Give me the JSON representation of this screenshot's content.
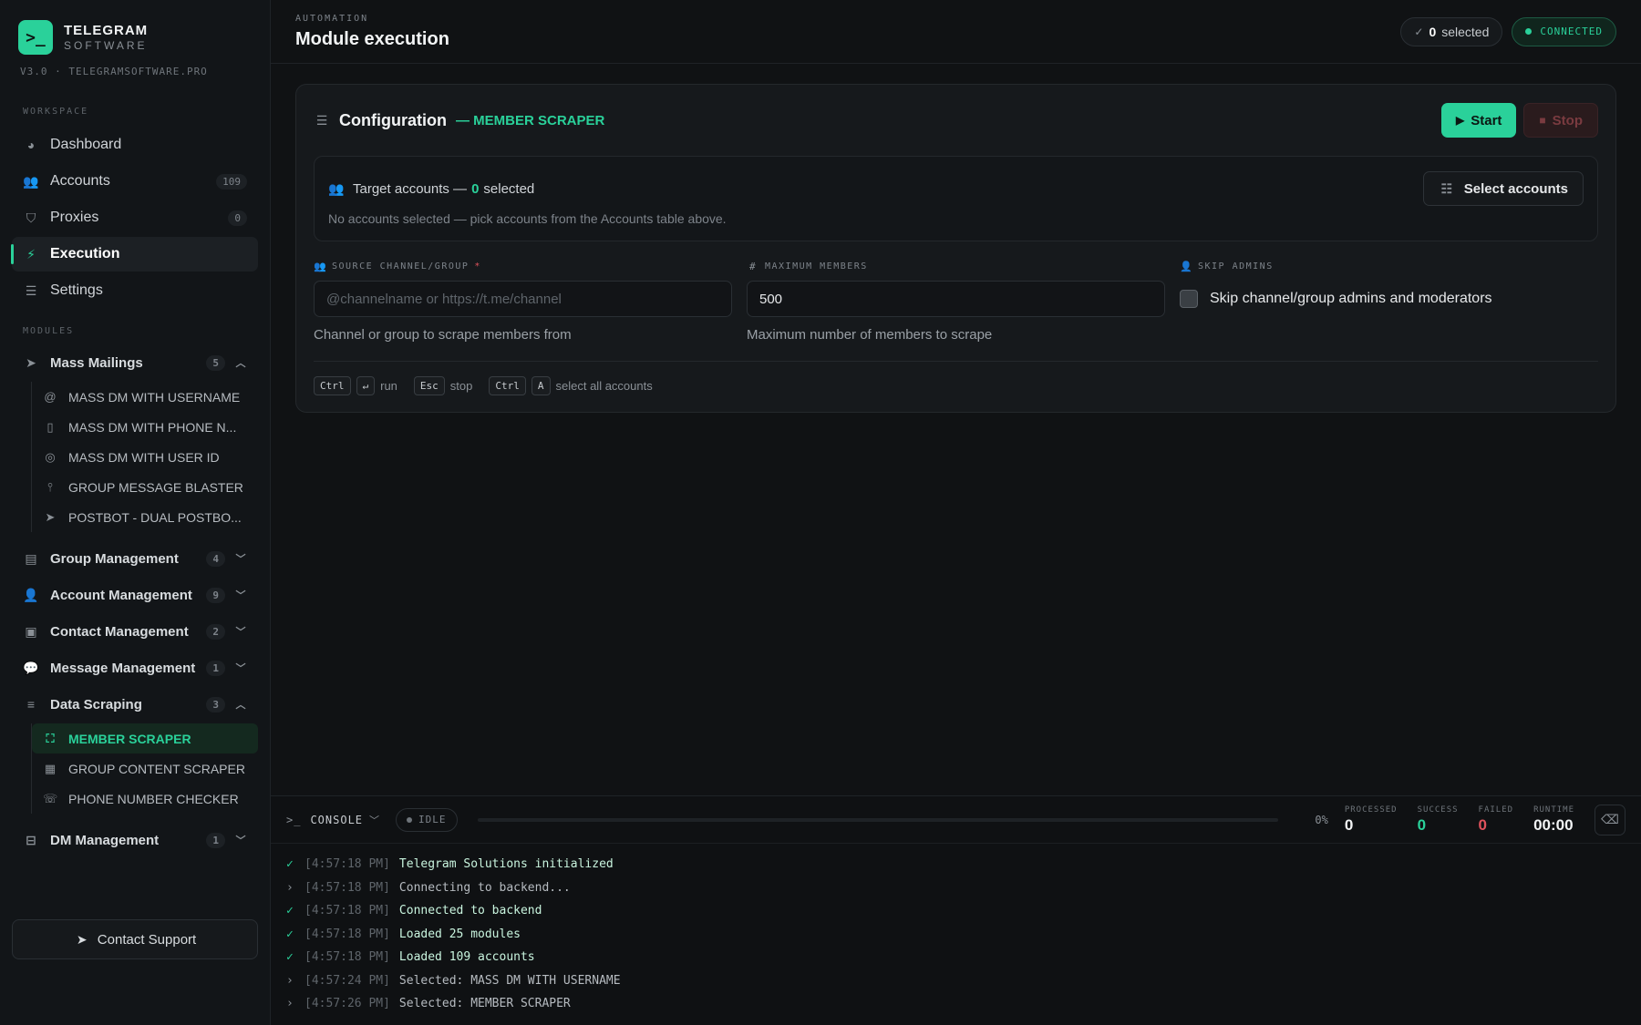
{
  "brand": {
    "name": "TELEGRAM",
    "sub": "SOFTWARE",
    "version": "V3.0 · TELEGRAMSOFTWARE.PRO",
    "logo_glyph": ">_"
  },
  "sidebar": {
    "workspace_label": "WORKSPACE",
    "workspace_items": [
      {
        "label": "Dashboard",
        "icon": "dashboard-icon",
        "count": ""
      },
      {
        "label": "Accounts",
        "icon": "users-icon",
        "count": "109"
      },
      {
        "label": "Proxies",
        "icon": "shield-icon",
        "count": "0"
      },
      {
        "label": "Execution",
        "icon": "bolt-icon",
        "count": "",
        "active": true
      },
      {
        "label": "Settings",
        "icon": "sliders-icon",
        "count": ""
      }
    ],
    "modules_label": "MODULES",
    "groups": [
      {
        "label": "Mass Mailings",
        "count": "5",
        "expanded": true,
        "items": [
          {
            "label": "MASS DM WITH USERNAME",
            "icon": "at-icon"
          },
          {
            "label": "MASS DM WITH PHONE N...",
            "icon": "phone-icon"
          },
          {
            "label": "MASS DM WITH USER ID",
            "icon": "fingerprint-icon"
          },
          {
            "label": "GROUP MESSAGE BLASTER",
            "icon": "antenna-icon"
          },
          {
            "label": "POSTBOT - DUAL POSTBO...",
            "icon": "send-icon"
          }
        ]
      },
      {
        "label": "Group Management",
        "count": "4",
        "expanded": false
      },
      {
        "label": "Account Management",
        "count": "9",
        "expanded": false
      },
      {
        "label": "Contact Management",
        "count": "2",
        "expanded": false
      },
      {
        "label": "Message Management",
        "count": "1",
        "expanded": false
      },
      {
        "label": "Data Scraping",
        "count": "3",
        "expanded": true,
        "items": [
          {
            "label": "MEMBER SCRAPER",
            "icon": "scan-icon",
            "active": true
          },
          {
            "label": "GROUP CONTENT SCRAPER",
            "icon": "images-icon"
          },
          {
            "label": "PHONE NUMBER CHECKER",
            "icon": "phone-call-icon"
          }
        ]
      },
      {
        "label": "DM Management",
        "count": "1",
        "expanded": false
      }
    ],
    "support_label": "Contact Support"
  },
  "header": {
    "eyebrow": "AUTOMATION",
    "title": "Module execution",
    "selected_count": "0",
    "selected_label": "selected",
    "status": "CONNECTED"
  },
  "config": {
    "title": "Configuration",
    "module": "— MEMBER SCRAPER",
    "start_label": "Start",
    "stop_label": "Stop",
    "targets": {
      "title_prefix": "Target accounts —",
      "count": "0",
      "title_suffix": "selected",
      "select_label": "Select accounts",
      "hint": "No accounts selected — pick accounts from the Accounts table above."
    },
    "fields": {
      "source": {
        "label": "SOURCE CHANNEL/GROUP",
        "required": "*",
        "placeholder": "@channelname or https://t.me/channel",
        "help": "Channel or group to scrape members from"
      },
      "max": {
        "label": "MAXIMUM MEMBERS",
        "value": "500",
        "help": "Maximum number of members to scrape"
      },
      "skip": {
        "label": "SKIP ADMINS",
        "text": "Skip channel/group admins and moderators",
        "checked": false
      }
    },
    "shortcuts": [
      {
        "keys": [
          "Ctrl",
          "↵"
        ],
        "text": "run"
      },
      {
        "keys": [
          "Esc"
        ],
        "text": "stop"
      },
      {
        "keys": [
          "Ctrl",
          "A"
        ],
        "text": "select all accounts"
      }
    ]
  },
  "console": {
    "label": "CONSOLE",
    "state": "IDLE",
    "progress": 0,
    "progress_text": "0%",
    "stats": {
      "processed_label": "PROCESSED",
      "processed": "0",
      "success_label": "SUCCESS",
      "success": "0",
      "failed_label": "FAILED",
      "failed": "0",
      "runtime_label": "RUNTIME",
      "runtime": "00:00"
    },
    "log": [
      {
        "mark": "✓",
        "ok": true,
        "time": "[4:57:18 PM]",
        "msg": "Telegram Solutions initialized"
      },
      {
        "mark": "›",
        "ok": false,
        "time": "[4:57:18 PM]",
        "msg": "Connecting to backend..."
      },
      {
        "mark": "✓",
        "ok": true,
        "time": "[4:57:18 PM]",
        "msg": "Connected to backend"
      },
      {
        "mark": "✓",
        "ok": true,
        "time": "[4:57:18 PM]",
        "msg": "Loaded 25 modules"
      },
      {
        "mark": "✓",
        "ok": true,
        "time": "[4:57:18 PM]",
        "msg": "Loaded 109 accounts"
      },
      {
        "mark": "›",
        "ok": false,
        "time": "[4:57:24 PM]",
        "msg": "Selected: MASS DM WITH USERNAME"
      },
      {
        "mark": "›",
        "ok": false,
        "time": "[4:57:26 PM]",
        "msg": "Selected: MEMBER SCRAPER"
      }
    ]
  },
  "colors": {
    "accent": "#2ad19a",
    "danger": "#e0525c",
    "bg": "#101214"
  }
}
